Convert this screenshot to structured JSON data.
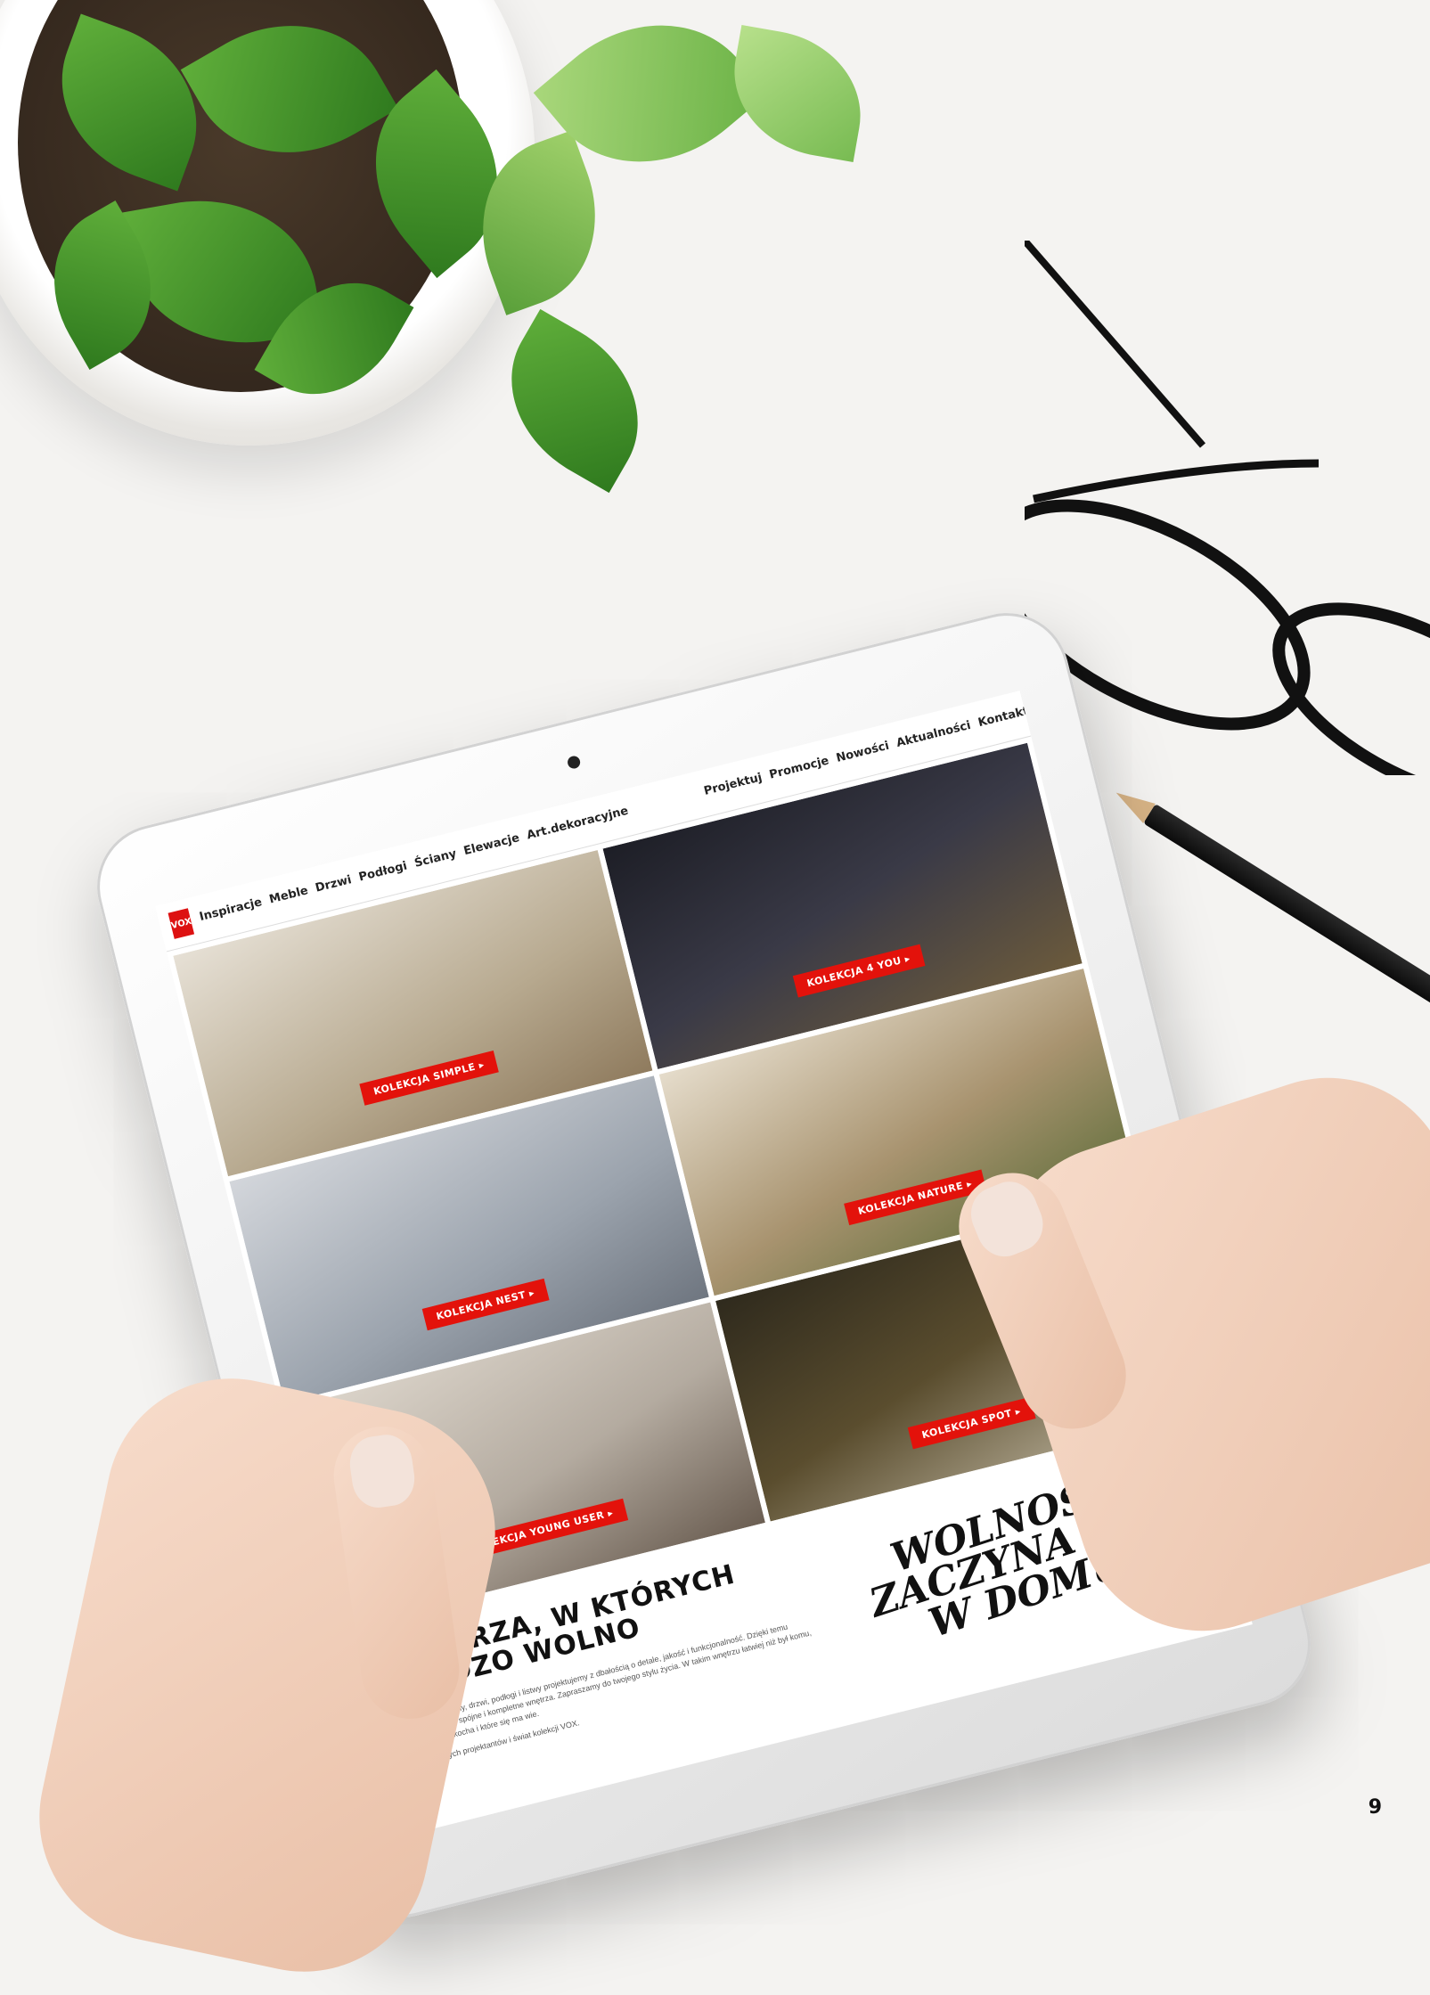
{
  "site": {
    "logo": "VOX",
    "nav_left": [
      "Inspiracje",
      "Meble",
      "Drzwi",
      "Podłogi",
      "Ściany",
      "Elewacje",
      "Art.dekoracyjne"
    ],
    "nav_right": [
      "Projektuj",
      "Promocje",
      "Nowości",
      "Aktualności",
      "Kontakt"
    ],
    "icons": [
      "search-icon",
      "cart-icon"
    ]
  },
  "collections": [
    {
      "label": "KOLEKCJA SIMPLE ▸",
      "tone": "#cfc6b5"
    },
    {
      "label": "KOLEKCJA 4 YOU ▸",
      "tone": "#2b2a33"
    },
    {
      "label": "KOLEKCJA NATURE ▸",
      "tone": "#b9ad96"
    },
    {
      "label": "KOLEKCJA NEST ▸",
      "tone": "#aeb4bd"
    },
    {
      "label": "KOLEKCJA SPOT ▸",
      "tone": "#3a3424"
    },
    {
      "label": "KOLEKCJA YOUNG USER ▸",
      "tone": "#c9c2b8"
    }
  ],
  "intro": {
    "title_line1": "WNĘTRZA, W KTÓRYCH",
    "title_line2": "BARDZO WOLNO",
    "body": "Kiedy meble, ściany, drzwi, podłogi i listwy projektujemy z dbałością o detale, jakość i funkcjonalność. Dzięki temu możemy tworzyć spójne i kompletne wnętrza. Zapraszamy do twojego stylu życia. W takim wnętrzu łatwiej niż był komu, który to już się kocha i które się ma wie.",
    "note": "Poznaj naszych projektantów i świat kolekcji VOX."
  },
  "slogan": {
    "line1": "WOLNOŚĆ",
    "line2": "ZACZYNA SIĘ",
    "line3": "W DOMU"
  },
  "page_number": "9",
  "colors": {
    "brand_red": "#e3120b",
    "background": "#f4f3f1"
  }
}
